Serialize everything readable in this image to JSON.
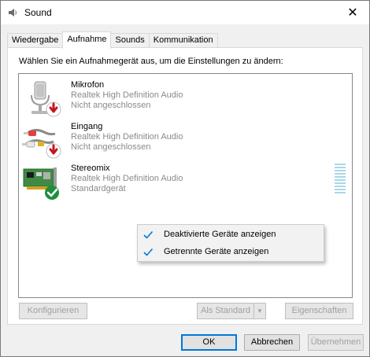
{
  "window": {
    "title": "Sound",
    "close_glyph": "✕"
  },
  "tabs": [
    {
      "label": "Wiedergabe",
      "active": false
    },
    {
      "label": "Aufnahme",
      "active": true
    },
    {
      "label": "Sounds",
      "active": false
    },
    {
      "label": "Kommunikation",
      "active": false
    }
  ],
  "instruction": "Wählen Sie ein Aufnahmegerät aus, um die Einstellungen zu ändern:",
  "devices": [
    {
      "name": "Mikrofon",
      "driver": "Realtek High Definition Audio",
      "status": "Nicht angeschlossen",
      "icon": "microphone-icon",
      "badge": "disconnected-badge-icon"
    },
    {
      "name": "Eingang",
      "driver": "Realtek High Definition Audio",
      "status": "Nicht angeschlossen",
      "icon": "line-in-cable-icon",
      "badge": "disconnected-badge-icon"
    },
    {
      "name": "Stereomix",
      "driver": "Realtek High Definition Audio",
      "status": "Standardgerät",
      "icon": "sound-card-icon",
      "badge": "default-check-badge-icon"
    }
  ],
  "context_menu": {
    "items": [
      {
        "label": "Deaktivierte Geräte anzeigen",
        "checked": true
      },
      {
        "label": "Getrennte Geräte anzeigen",
        "checked": true
      }
    ]
  },
  "panel_buttons": {
    "configure": "Konfigurieren",
    "set_default": "Als Standard",
    "properties": "Eigenschaften"
  },
  "dialog_buttons": {
    "ok": "OK",
    "cancel": "Abbrechen",
    "apply": "Übernehmen"
  },
  "colors": {
    "accent": "#0078d7",
    "error_red": "#c4161c",
    "success_green": "#1e8e3e",
    "meter": "#a8d8e8"
  }
}
